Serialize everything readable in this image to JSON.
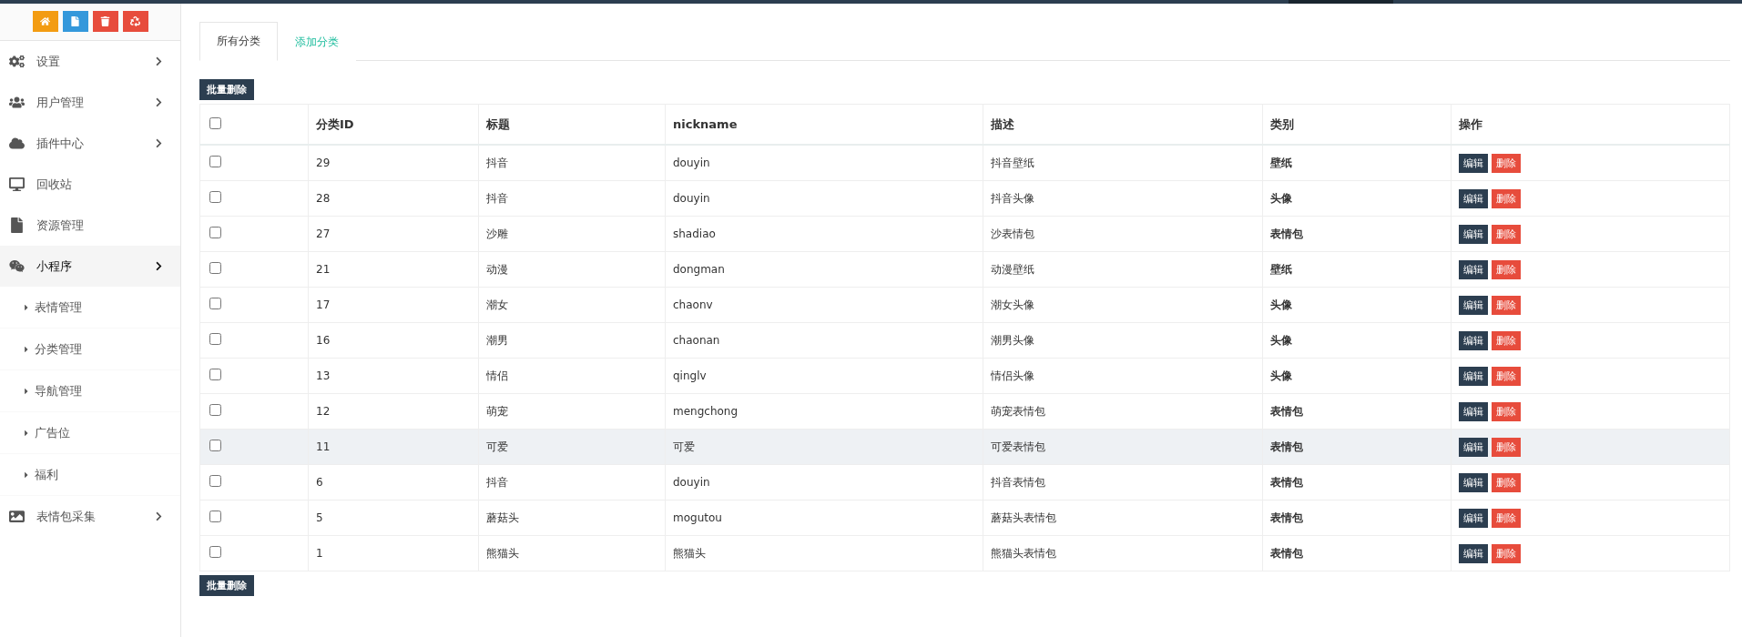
{
  "sidebar": {
    "shortcuts": [
      {
        "kind": "home",
        "color": "#f39c12"
      },
      {
        "kind": "file",
        "color": "#3498db"
      },
      {
        "kind": "trash",
        "color": "#e74c3c"
      },
      {
        "kind": "recycle",
        "color": "#e74c3c"
      }
    ],
    "items": [
      {
        "label": "设置",
        "has_arrow": true,
        "expanded": false
      },
      {
        "label": "用户管理",
        "has_arrow": true,
        "expanded": false
      },
      {
        "label": "插件中心",
        "has_arrow": true,
        "expanded": false
      },
      {
        "label": "回收站",
        "has_arrow": false,
        "expanded": false
      },
      {
        "label": "资源管理",
        "has_arrow": false,
        "expanded": false
      },
      {
        "label": "小程序",
        "has_arrow": true,
        "expanded": true,
        "children": [
          {
            "label": "表情管理"
          },
          {
            "label": "分类管理"
          },
          {
            "label": "导航管理"
          },
          {
            "label": "广告位"
          },
          {
            "label": "福利"
          }
        ]
      },
      {
        "label": "表情包采集",
        "has_arrow": true,
        "expanded": false
      }
    ]
  },
  "tabs": [
    {
      "label": "所有分类",
      "selected": true
    },
    {
      "label": "添加分类",
      "selected": false
    }
  ],
  "batch_delete_top": "批量删除",
  "table": {
    "select_all_checked": false,
    "columns": [
      "分类ID",
      "标题",
      "nickname",
      "描述",
      "类别",
      "操作"
    ],
    "rows": [
      {
        "checked": false,
        "highlighted": false,
        "cells": [
          "29",
          "抖音",
          "douyin",
          "抖音壁纸",
          "壁纸"
        ],
        "actions": [
          "编辑",
          "删除"
        ]
      },
      {
        "checked": false,
        "highlighted": false,
        "cells": [
          "28",
          "抖音",
          "douyin",
          "抖音头像",
          "头像"
        ],
        "actions": [
          "编辑",
          "删除"
        ]
      },
      {
        "checked": false,
        "highlighted": false,
        "cells": [
          "27",
          "沙雕",
          "shadiao",
          "沙表情包",
          "表情包"
        ],
        "actions": [
          "编辑",
          "删除"
        ]
      },
      {
        "checked": false,
        "highlighted": false,
        "cells": [
          "21",
          "动漫",
          "dongman",
          "动漫壁纸",
          "壁纸"
        ],
        "actions": [
          "编辑",
          "删除"
        ]
      },
      {
        "checked": false,
        "highlighted": false,
        "cells": [
          "17",
          "潮女",
          "chaonv",
          "潮女头像",
          "头像"
        ],
        "actions": [
          "编辑",
          "删除"
        ]
      },
      {
        "checked": false,
        "highlighted": false,
        "cells": [
          "16",
          "潮男",
          "chaonan",
          "潮男头像",
          "头像"
        ],
        "actions": [
          "编辑",
          "删除"
        ]
      },
      {
        "checked": false,
        "highlighted": false,
        "cells": [
          "13",
          "情侣",
          "qinglv",
          "情侣头像",
          "头像"
        ],
        "actions": [
          "编辑",
          "删除"
        ]
      },
      {
        "checked": false,
        "highlighted": false,
        "cells": [
          "12",
          "萌宠",
          "mengchong",
          "萌宠表情包",
          "表情包"
        ],
        "actions": [
          "编辑",
          "删除"
        ]
      },
      {
        "checked": false,
        "highlighted": true,
        "cells": [
          "11",
          "可爱",
          "可爱",
          "可爱表情包",
          "表情包"
        ],
        "actions": [
          "编辑",
          "删除"
        ]
      },
      {
        "checked": false,
        "highlighted": false,
        "cells": [
          "6",
          "抖音",
          "douyin",
          "抖音表情包",
          "表情包"
        ],
        "actions": [
          "编辑",
          "删除"
        ]
      },
      {
        "checked": false,
        "highlighted": false,
        "cells": [
          "5",
          "蘑菇头",
          "mogutou",
          "蘑菇头表情包",
          "表情包"
        ],
        "actions": [
          "编辑",
          "删除"
        ]
      },
      {
        "checked": false,
        "highlighted": false,
        "cells": [
          "1",
          "熊猫头",
          "熊猫头",
          "熊猫头表情包",
          "表情包"
        ],
        "actions": [
          "编辑",
          "删除"
        ]
      }
    ]
  },
  "batch_delete_bottom": "批量删除"
}
